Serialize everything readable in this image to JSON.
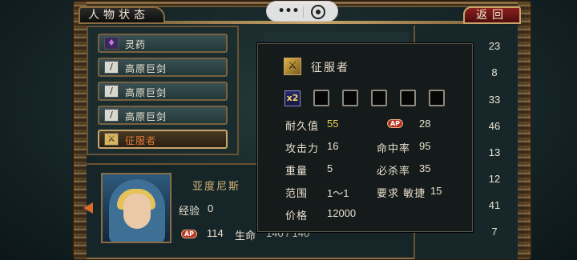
{
  "header": {
    "title": "人物状态",
    "back_label": "返回"
  },
  "miniapp": {
    "more_icon": "•••",
    "close_icon": "target-circle-icon"
  },
  "items": [
    {
      "label": "灵药",
      "icon": "potion-icon",
      "selected": false
    },
    {
      "label": "高原巨剑",
      "icon": "sword-icon",
      "selected": false
    },
    {
      "label": "高原巨剑",
      "icon": "sword-icon",
      "selected": false
    },
    {
      "label": "高原巨剑",
      "icon": "sword-icon",
      "selected": false
    },
    {
      "label": "征服者",
      "icon": "conqueror-weapon-icon",
      "selected": true
    }
  ],
  "right_numbers": [
    "23",
    "8",
    "33",
    "46",
    "13",
    "12",
    "41",
    "7"
  ],
  "character": {
    "name": "亚度尼斯",
    "exp_label": "经验",
    "exp_value": "0",
    "ap_badge": "AP",
    "ap_value": "114",
    "hp_label": "生命",
    "hp_value": "140 / 140"
  },
  "tooltip": {
    "item_name": "征服者",
    "socket_multiplier": "x2",
    "socket_count": 5,
    "stats": {
      "durability_label": "耐久值",
      "durability_value": "55",
      "ap_badge": "AP",
      "ap_value": "28",
      "attack_label": "攻击力",
      "attack_value": "16",
      "hit_label": "命中率",
      "hit_value": "95",
      "weight_label": "重量",
      "weight_value": "5",
      "crit_label": "必杀率",
      "crit_value": "35",
      "range_label": "范围",
      "range_value": "1～1",
      "req_label": "要求 敏捷",
      "req_value": "15",
      "price_label": "价格",
      "price_value": "12000"
    }
  },
  "colors": {
    "frame_gold": "#8a6d43",
    "back_button_red": "#8a1f1f",
    "durability_yellow": "#e2d35a",
    "selected_item_orange": "#e07a3a"
  }
}
